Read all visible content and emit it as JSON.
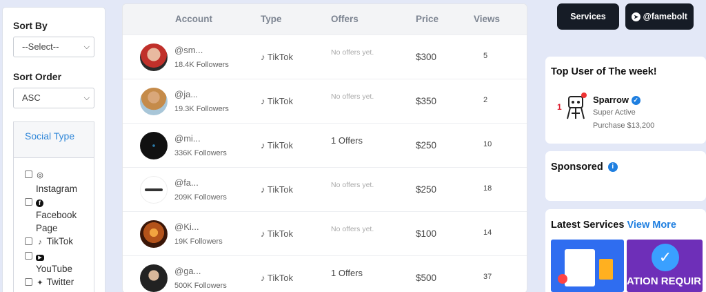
{
  "filters": {
    "sort_by_label": "Sort By",
    "sort_by_value": "--Select--",
    "sort_order_label": "Sort Order",
    "sort_order_value": "ASC",
    "social_type_label": "Social Type",
    "social_options": [
      {
        "label": "Instagram",
        "icon": "instagram-icon"
      },
      {
        "label": "Facebook Page",
        "icon": "facebook-icon"
      },
      {
        "label": "TikTok",
        "icon": "tiktok-icon"
      },
      {
        "label": "YouTube",
        "icon": "youtube-icon"
      },
      {
        "label": "Twitter",
        "icon": "twitter-icon"
      }
    ]
  },
  "table": {
    "headers": {
      "account": "Account",
      "type": "Type",
      "offers": "Offers",
      "price": "Price",
      "views": "Views"
    },
    "rows": [
      {
        "handle": "@sm...",
        "followers": "18.4K Followers",
        "type": "TikTok",
        "offers": "No offers yet.",
        "price": "$300",
        "views": "5"
      },
      {
        "handle": "@ja...",
        "followers": "19.3K Followers",
        "type": "TikTok",
        "offers": "No offers yet.",
        "price": "$350",
        "views": "2"
      },
      {
        "handle": "@mi...",
        "followers": "336K Followers",
        "type": "TikTok",
        "offers": "1 Offers",
        "price": "$250",
        "views": "10"
      },
      {
        "handle": "@fa...",
        "followers": "209K Followers",
        "type": "TikTok",
        "offers": "No offers yet.",
        "price": "$250",
        "views": "18"
      },
      {
        "handle": "@Ki...",
        "followers": "19K Followers",
        "type": "TikTok",
        "offers": "No offers yet.",
        "price": "$100",
        "views": "14"
      },
      {
        "handle": "@ga...",
        "followers": "500K Followers",
        "type": "TikTok",
        "offers": "1 Offers",
        "price": "$500",
        "views": "37"
      }
    ]
  },
  "topbar": {
    "services_label": "Services",
    "telegram_label": "@famebolt"
  },
  "top_user": {
    "title": "Top User of The week!",
    "rank": "1",
    "name": "Sparrow",
    "status": "Super Active",
    "purchase": "Purchase $13,200"
  },
  "sponsored": {
    "title": "Sponsored"
  },
  "latest": {
    "title": "Latest Services",
    "view_more": "View More",
    "tile2_text": "ATION REQUIR"
  },
  "colors": {
    "accent": "#1f7fe0",
    "dark_button": "#161c26",
    "background": "#e3e8f7"
  }
}
